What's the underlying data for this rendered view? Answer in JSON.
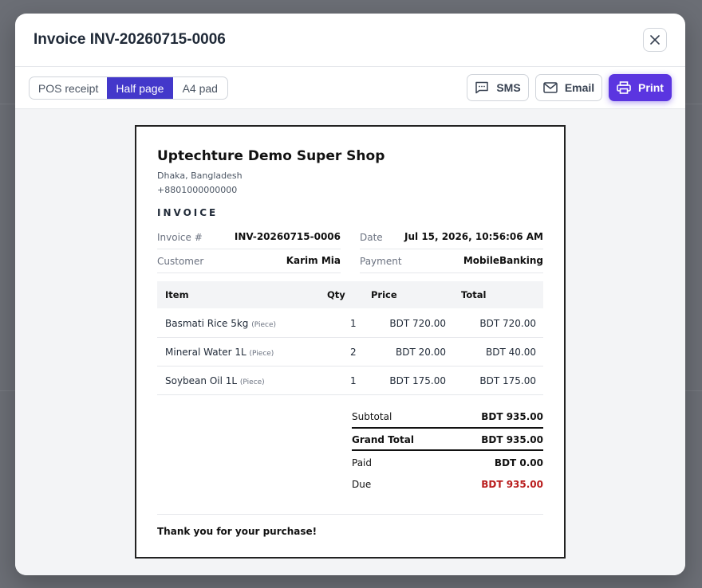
{
  "modal": {
    "title": "Invoice INV-20260715-0006"
  },
  "toolbar": {
    "formats": [
      "POS receipt",
      "Half page",
      "A4 pad"
    ],
    "active_format": "Half page",
    "sms_label": "SMS",
    "email_label": "Email",
    "print_label": "Print"
  },
  "invoice": {
    "shop_name": "Uptechture Demo Super Shop",
    "address": "Dhaka, Bangladesh",
    "phone": "+8801000000000",
    "heading": "INVOICE",
    "meta": {
      "invoice_label": "Invoice #",
      "invoice_no": "INV-20260715-0006",
      "date_label": "Date",
      "date": "Jul 15, 2026, 10:56:06 AM",
      "customer_label": "Customer",
      "customer": "Karim Mia",
      "payment_label": "Payment",
      "payment": "MobileBanking"
    },
    "columns": [
      "Item",
      "Qty",
      "Price",
      "Total"
    ],
    "items": [
      {
        "name": "Basmati Rice 5kg",
        "unit": "(Piece)",
        "qty": "1",
        "price": "BDT 720.00",
        "total": "BDT 720.00"
      },
      {
        "name": "Mineral Water 1L",
        "unit": "(Piece)",
        "qty": "2",
        "price": "BDT 20.00",
        "total": "BDT 40.00"
      },
      {
        "name": "Soybean Oil 1L",
        "unit": "(Piece)",
        "qty": "1",
        "price": "BDT 175.00",
        "total": "BDT 175.00"
      }
    ],
    "summary": {
      "subtotal_label": "Subtotal",
      "subtotal": "BDT 935.00",
      "grand_label": "Grand Total",
      "grand": "BDT 935.00",
      "paid_label": "Paid",
      "paid": "BDT 0.00",
      "due_label": "Due",
      "due": "BDT 935.00"
    },
    "thanks": "Thank you for your purchase!"
  },
  "colors": {
    "accent": "#4338ca",
    "primary_button": "#5b35e0",
    "due": "#b91c1c"
  },
  "icons": {
    "sms": "message-square-icon",
    "email": "mail-icon",
    "print": "printer-icon",
    "close": "close-icon"
  }
}
